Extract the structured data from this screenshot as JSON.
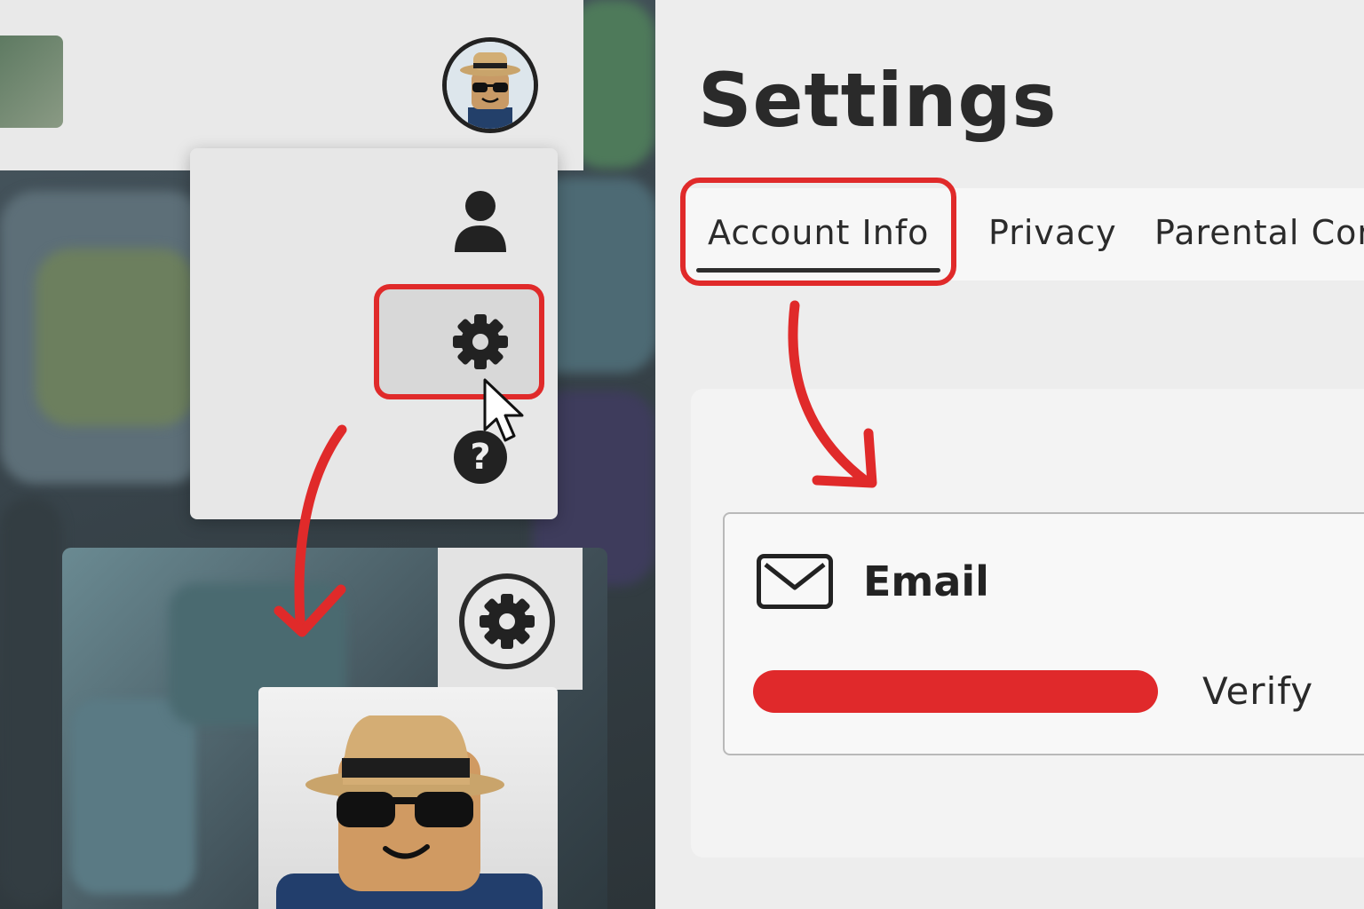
{
  "settings_page": {
    "title": "Settings",
    "tabs": [
      {
        "label": "Account Info",
        "active": true
      },
      {
        "label": "Privacy",
        "active": false
      },
      {
        "label": "Parental Cor",
        "active": false
      }
    ],
    "email_section": {
      "label": "Email",
      "value_redacted": true,
      "verify_label": "Verify"
    }
  },
  "dropdown_menu": {
    "items": [
      {
        "icon": "person-icon"
      },
      {
        "icon": "gear-icon",
        "highlighted": true
      },
      {
        "icon": "question-icon"
      }
    ]
  },
  "annotations": {
    "highlight_color": "#e02a2a",
    "arrow_color": "#e02a2a"
  }
}
